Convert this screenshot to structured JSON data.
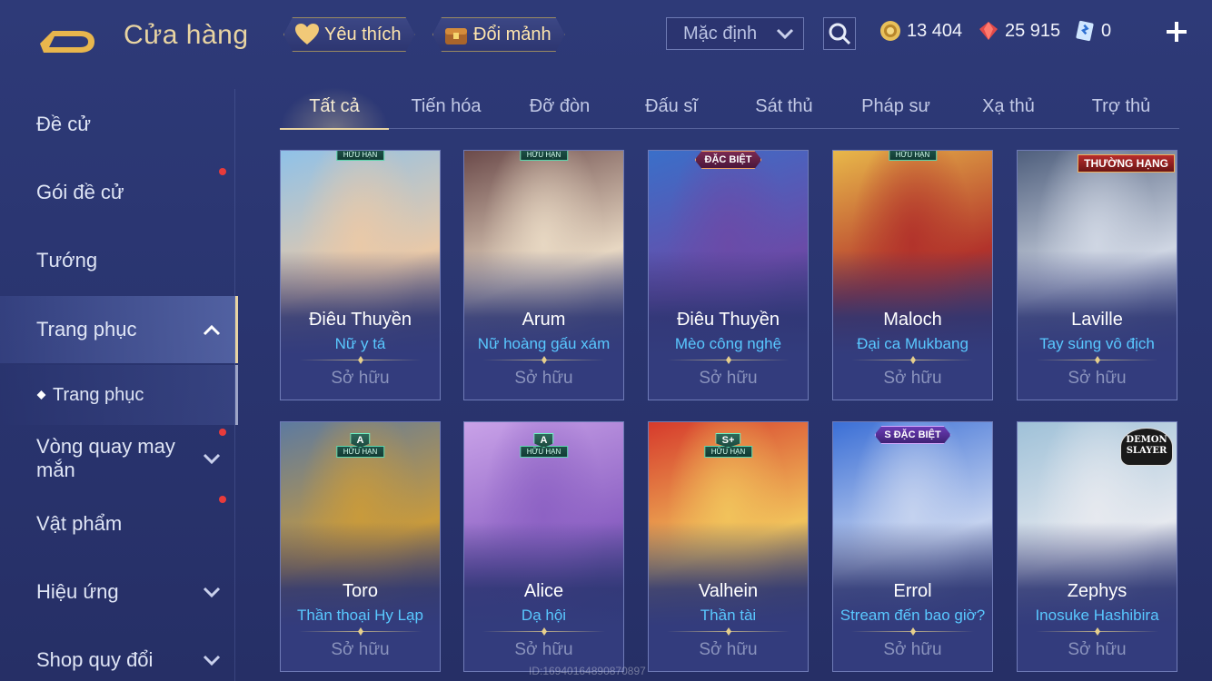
{
  "header": {
    "title": "Cửa hàng",
    "favorite_label": "Yêu thích",
    "exchange_label": "Đổi mảnh",
    "sort_value": "Mặc định",
    "currencies": [
      {
        "icon": "gold-coin-icon",
        "value": "13 404"
      },
      {
        "icon": "red-diamond-icon",
        "value": "25 915"
      },
      {
        "icon": "blue-voucher-icon",
        "value": "0"
      }
    ]
  },
  "sidebar": {
    "items": [
      {
        "label": "Đề cử"
      },
      {
        "label": "Gói đề cử"
      },
      {
        "label": "Tướng"
      },
      {
        "label": "Trang phục"
      },
      {
        "label": "Trang phục"
      },
      {
        "label": "Vòng quay may mắn"
      },
      {
        "label": "Vật phẩm"
      },
      {
        "label": "Hiệu ứng"
      },
      {
        "label": "Shop quy đổi"
      }
    ]
  },
  "tabs": [
    "Tất cả",
    "Tiến hóa",
    "Đỡ đòn",
    "Đấu sĩ",
    "Sát thủ",
    "Pháp sư",
    "Xạ thủ",
    "Trợ thủ"
  ],
  "badges": {
    "limited": "HỮU HẠN",
    "special": "ĐẶC BIỆT",
    "ranked": "THƯỜNG HẠNG",
    "tier_a": "A",
    "tier_s_plus": "S+",
    "tier_s": "S",
    "demon_slayer": "DEMON SLAYER"
  },
  "cards": [
    {
      "hero": "Điêu Thuyền",
      "skin": "Nữ y tá",
      "status": "Sở hữu",
      "colors": [
        "#8fc1e8",
        "#e9c9a8"
      ]
    },
    {
      "hero": "Arum",
      "skin": "Nữ hoàng gấu xám",
      "status": "Sở hữu",
      "colors": [
        "#6b4a4a",
        "#e7d7c2"
      ]
    },
    {
      "hero": "Điêu Thuyền",
      "skin": "Mèo công nghệ",
      "status": "Sở hữu",
      "colors": [
        "#3a6fc9",
        "#6a4ba8"
      ]
    },
    {
      "hero": "Maloch",
      "skin": "Đại ca Mukbang",
      "status": "Sở hữu",
      "colors": [
        "#e8b84a",
        "#b2332b"
      ]
    },
    {
      "hero": "Laville",
      "skin": "Tay súng vô địch",
      "status": "Sở hữu",
      "colors": [
        "#4f5f7d",
        "#cfd6e3"
      ]
    },
    {
      "hero": "Toro",
      "skin": "Thần thoại Hy Lạp",
      "status": "Sở hữu",
      "colors": [
        "#5d7aa0",
        "#c89a3c"
      ]
    },
    {
      "hero": "Alice",
      "skin": "Dạ hội",
      "status": "Sở hữu",
      "colors": [
        "#c9a2e8",
        "#8d62c4"
      ]
    },
    {
      "hero": "Valhein",
      "skin": "Thần tài",
      "status": "Sở hữu",
      "colors": [
        "#d63a2c",
        "#f1c25b"
      ]
    },
    {
      "hero": "Errol",
      "skin": "Stream đến bao giờ?",
      "status": "Sở hữu",
      "colors": [
        "#3b6fd6",
        "#c4d2ef"
      ]
    },
    {
      "hero": "Zephys",
      "skin": "Inosuke Hashibira",
      "status": "Sở hữu",
      "colors": [
        "#9fc1d8",
        "#e6e9ef"
      ]
    }
  ],
  "watermark": "ID:1694016489087​0897"
}
